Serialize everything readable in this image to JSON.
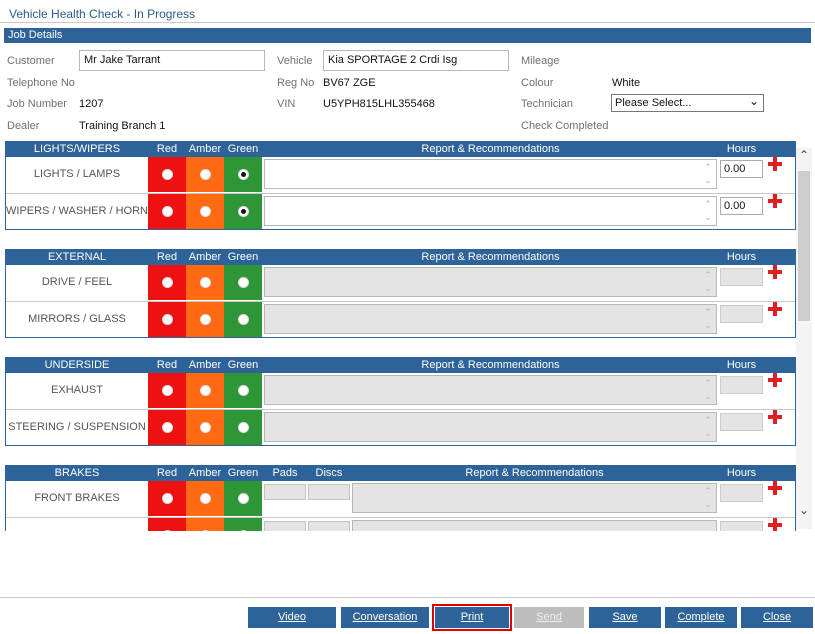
{
  "title": "Vehicle Health Check - In Progress",
  "job_details": {
    "header": "Job Details",
    "customer_label": "Customer",
    "customer_value": "Mr Jake Tarrant",
    "telephone_label": "Telephone No",
    "job_number_label": "Job Number",
    "job_number_value": "1207",
    "dealer_label": "Dealer",
    "dealer_value": "Training Branch 1",
    "vehicle_label": "Vehicle",
    "vehicle_value": "Kia SPORTAGE 2 Crdi Isg",
    "reg_label": "Reg No",
    "reg_value": "BV67 ZGE",
    "vin_label": "VIN",
    "vin_value": "U5YPH815LHL355468",
    "mileage_label": "Mileage",
    "colour_label": "Colour",
    "colour_value": "White",
    "technician_label": "Technician",
    "technician_value": "Please Select...",
    "check_completed_label": "Check Completed"
  },
  "columns": {
    "red": "Red",
    "amber": "Amber",
    "green": "Green",
    "report": "Report & Recommendations",
    "hours": "Hours",
    "pads": "Pads",
    "discs": "Discs"
  },
  "sections": {
    "lights": {
      "title": "LIGHTS/WIPERS",
      "rows": [
        {
          "name": "LIGHTS / LAMPS",
          "hours": "0.00",
          "selected": "green"
        },
        {
          "name": "WIPERS / WASHER / HORN",
          "hours": "0.00",
          "selected": "green"
        }
      ]
    },
    "external": {
      "title": "EXTERNAL",
      "rows": [
        {
          "name": "DRIVE / FEEL"
        },
        {
          "name": "MIRRORS / GLASS"
        }
      ]
    },
    "underside": {
      "title": "UNDERSIDE",
      "rows": [
        {
          "name": "EXHAUST"
        },
        {
          "name": "STEERING / SUSPENSION"
        }
      ]
    },
    "brakes": {
      "title": "BRAKES",
      "rows": [
        {
          "name": "FRONT BRAKES"
        },
        {
          "name": ""
        }
      ]
    }
  },
  "buttons": {
    "video": "Video",
    "conversation": "Conversation",
    "print": "Print",
    "send": "Send",
    "save": "Save",
    "complete": "Complete",
    "close": "Close"
  },
  "colors": {
    "header_blue": "#2d6399",
    "red": "#ee1111",
    "amber": "#ff6a13",
    "green": "#2e9637",
    "highlight": "#e00000"
  }
}
